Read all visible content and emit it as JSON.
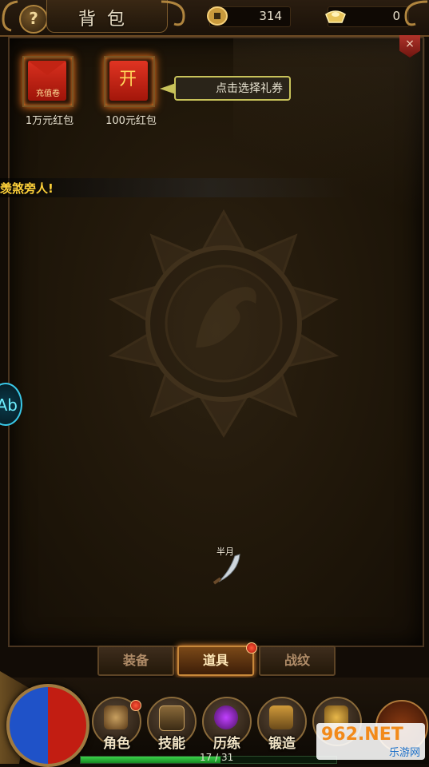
{
  "header": {
    "title": "背包",
    "help_label": "?",
    "coins": "314",
    "ingots": "0"
  },
  "close_label": "×",
  "gifts": [
    {
      "badge": "充值卷",
      "label": "1万元红包"
    },
    {
      "badge": "开",
      "label": "100元红包"
    }
  ],
  "tooltip": "点击选择礼券",
  "marquee": "羡煞旁人!",
  "side_orb_label": "Ab",
  "item": {
    "name": "半月"
  },
  "tabs": [
    {
      "label": "装备",
      "active": false
    },
    {
      "label": "道具",
      "active": true
    },
    {
      "label": "战纹",
      "active": false
    }
  ],
  "menu": [
    {
      "label": "角色"
    },
    {
      "label": "技能"
    },
    {
      "label": "历练"
    },
    {
      "label": "锻造"
    }
  ],
  "exp": {
    "text": "17 / 31",
    "fraction": 0.548
  },
  "watermark": {
    "main": "962.NET",
    "sub": "乐游网"
  },
  "colors": {
    "accent": "#c8883a",
    "gold_text": "#ffd23a",
    "tooltip_border": "#c8c25a"
  }
}
